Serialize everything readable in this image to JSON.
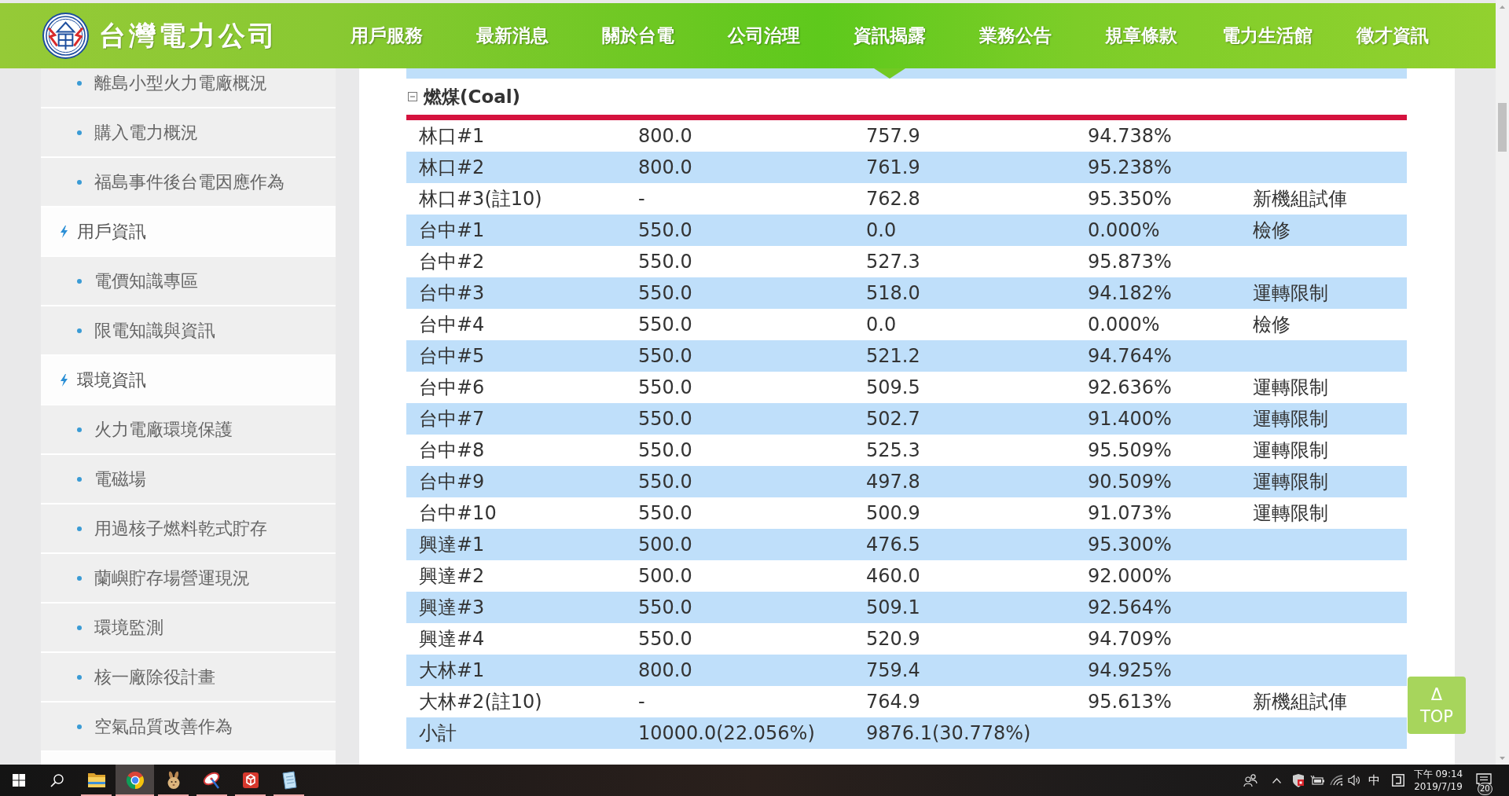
{
  "header": {
    "logo_text": "台灣電力公司",
    "nav": [
      {
        "label": "用戶服務",
        "selected": false
      },
      {
        "label": "最新消息",
        "selected": false
      },
      {
        "label": "關於台電",
        "selected": false
      },
      {
        "label": "公司治理",
        "selected": false
      },
      {
        "label": "資訊揭露",
        "selected": true
      },
      {
        "label": "業務公告",
        "selected": false
      },
      {
        "label": "規章條款",
        "selected": false
      },
      {
        "label": "電力生活館",
        "selected": false
      },
      {
        "label": "徵才資訊",
        "selected": false
      }
    ]
  },
  "sidebar": {
    "items": [
      {
        "kind": "link",
        "label": "離島小型火力電廠概況"
      },
      {
        "kind": "link",
        "label": "購入電力概況"
      },
      {
        "kind": "link",
        "label": "福島事件後台電因應作為"
      },
      {
        "kind": "category",
        "label": "用戶資訊"
      },
      {
        "kind": "link",
        "label": "電價知識專區"
      },
      {
        "kind": "link",
        "label": "限電知識與資訊"
      },
      {
        "kind": "category",
        "label": "環境資訊"
      },
      {
        "kind": "link",
        "label": "火力電廠環境保護"
      },
      {
        "kind": "link",
        "label": "電磁場"
      },
      {
        "kind": "link",
        "label": "用過核子燃料乾式貯存"
      },
      {
        "kind": "link",
        "label": "蘭嶼貯存場營運現況"
      },
      {
        "kind": "link",
        "label": "環境監測"
      },
      {
        "kind": "link",
        "label": "核一廠除役計畫"
      },
      {
        "kind": "link",
        "label": "空氣品質改善作為"
      }
    ]
  },
  "section": {
    "title": "燃煤(Coal)",
    "expanded": true,
    "rows": [
      {
        "cells": [
          "林口#1",
          "800.0",
          "757.9",
          "94.738%"
        ]
      },
      {
        "cells": [
          "林口#2",
          "800.0",
          "761.9",
          "95.238%"
        ]
      },
      {
        "cells": [
          "林口#3(註10)",
          "-",
          "762.8",
          "95.350%",
          "新機組試俥"
        ]
      },
      {
        "cells": [
          "台中#1",
          "550.0",
          "0.0",
          "0.000%",
          "檢修"
        ]
      },
      {
        "cells": [
          "台中#2",
          "550.0",
          "527.3",
          "95.873%"
        ]
      },
      {
        "cells": [
          "台中#3",
          "550.0",
          "518.0",
          "94.182%",
          "運轉限制"
        ]
      },
      {
        "cells": [
          "台中#4",
          "550.0",
          "0.0",
          "0.000%",
          "檢修"
        ]
      },
      {
        "cells": [
          "台中#5",
          "550.0",
          "521.2",
          "94.764%"
        ]
      },
      {
        "cells": [
          "台中#6",
          "550.0",
          "509.5",
          "92.636%",
          "運轉限制"
        ]
      },
      {
        "cells": [
          "台中#7",
          "550.0",
          "502.7",
          "91.400%",
          "運轉限制"
        ]
      },
      {
        "cells": [
          "台中#8",
          "550.0",
          "525.3",
          "95.509%",
          "運轉限制"
        ]
      },
      {
        "cells": [
          "台中#9",
          "550.0",
          "497.8",
          "90.509%",
          "運轉限制"
        ]
      },
      {
        "cells": [
          "台中#10",
          "550.0",
          "500.9",
          "91.073%",
          "運轉限制"
        ]
      },
      {
        "cells": [
          "興達#1",
          "500.0",
          "476.5",
          "95.300%"
        ]
      },
      {
        "cells": [
          "興達#2",
          "500.0",
          "460.0",
          "92.000%"
        ]
      },
      {
        "cells": [
          "興達#3",
          "550.0",
          "509.1",
          "92.564%"
        ]
      },
      {
        "cells": [
          "興達#4",
          "550.0",
          "520.9",
          "94.709%"
        ]
      },
      {
        "cells": [
          "大林#1",
          "800.0",
          "759.4",
          "94.925%"
        ]
      },
      {
        "cells": [
          "大林#2(註10)",
          "-",
          "764.9",
          "95.613%",
          "新機組試俥"
        ]
      },
      {
        "cells": [
          "小計",
          "10000.0(22.056%)",
          "9876.1(30.778%)"
        ]
      }
    ]
  },
  "top_button": {
    "symbol": "Δ",
    "label": "TOP"
  },
  "taskbar": {
    "apps": [
      {
        "kind": "folder",
        "running": true,
        "selected": false
      },
      {
        "kind": "browser",
        "running": true,
        "selected": true
      },
      {
        "kind": "rabbit",
        "running": true,
        "selected": false
      },
      {
        "kind": "dish",
        "running": true,
        "selected": false
      },
      {
        "kind": "cube",
        "running": true,
        "selected": false
      },
      {
        "kind": "notepad",
        "running": true,
        "selected": false
      }
    ],
    "input_language": "中",
    "time": "下午 09:14",
    "date": "2019/7/19",
    "notification_count": "20"
  }
}
